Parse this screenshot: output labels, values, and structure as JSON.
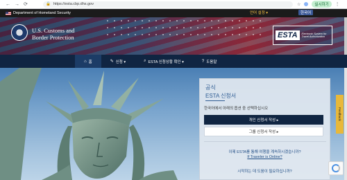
{
  "browser": {
    "back": "←",
    "forward": "→",
    "reload": "⟳",
    "url": "https://esta.cbp.dhs.gov",
    "resume_label": "실시하기"
  },
  "gov_banner": {
    "text": "Department of Homeland Security",
    "language_link": "언어 설정 ▾",
    "language_value": "한국어"
  },
  "header": {
    "agency_name": "U.S. Customs and\nBorder Protection",
    "logo_word": "ESTA",
    "logo_tagline": "Electronic System for Travel Authorization"
  },
  "nav": {
    "items": [
      {
        "label": "홈",
        "icon": "home-icon"
      },
      {
        "label": "신청 ▾",
        "icon": "pencil-icon"
      },
      {
        "label": "ESTA 신청상황 확인 ▾",
        "icon": "search-icon"
      },
      {
        "label": "도움말",
        "icon": "help-icon"
      }
    ]
  },
  "card": {
    "kicker": "공식",
    "title": "ESTA 신청서",
    "intro": "한국어에서 아래의 옵션 중 선택하십시오",
    "primary_button": "개인 신청서 작성 ▸",
    "secondary_button": "그룹 신청서 작성 ▸",
    "question1": "이제 ESTA를 통해 여행을 계속하시겠습니까?",
    "question2": "If Traveler is Online?",
    "question3": "시작하는 데 도움이 필요하십니까?"
  },
  "feedback_label": "Feedback",
  "colors": {
    "nav_bg": "#102542",
    "accent_blue": "#2f5d93",
    "feedback_tab": "#e8b83a"
  }
}
